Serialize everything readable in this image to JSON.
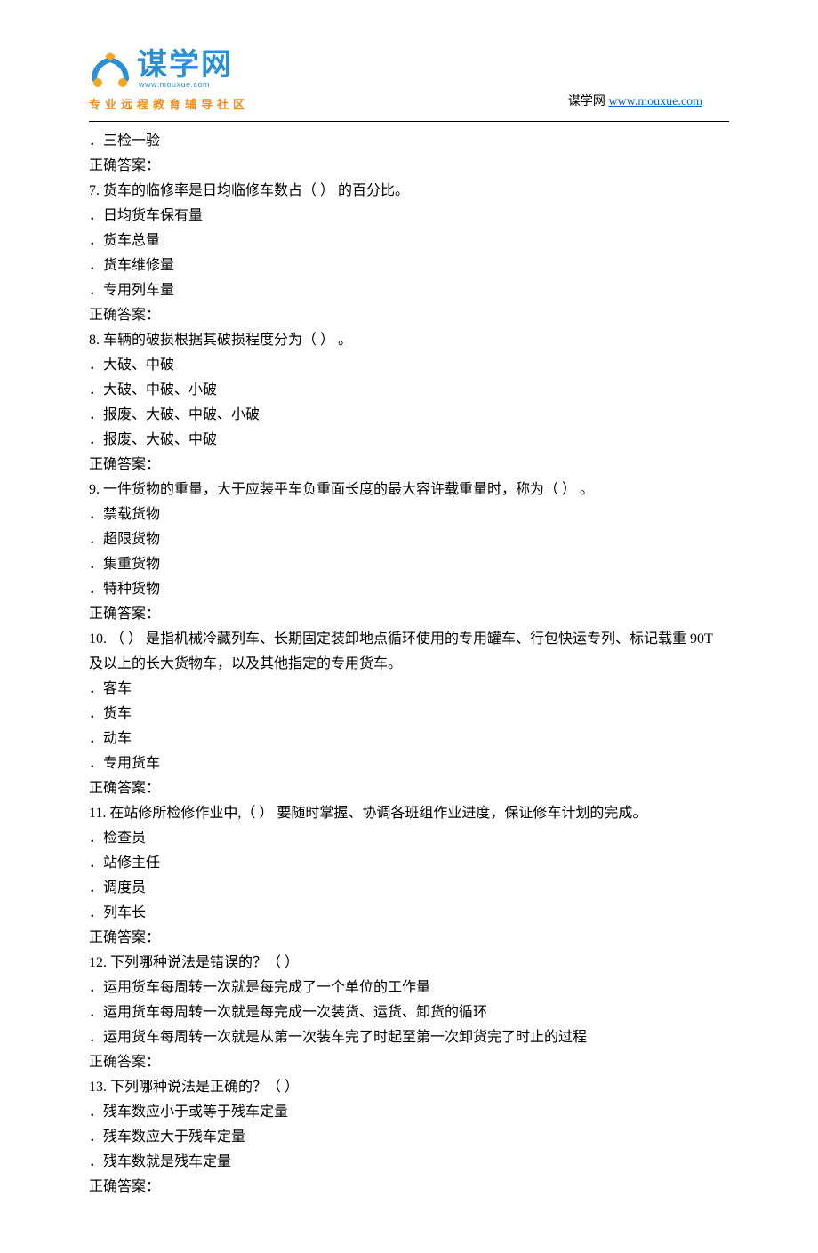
{
  "header": {
    "logo_text": "谋学网",
    "logo_url": "www.mouxue.com",
    "logo_sub": "专业远程教育辅导社区",
    "right_label": "谋学网",
    "right_link": "www.mouxue.com"
  },
  "q6_tail_opt": "．三检一验",
  "answer_label": "正确答案：",
  "q7": {
    "stem": "7.   货车的临修率是日均临修车数占（ ） 的百分比。",
    "opts": [
      "．日均货车保有量",
      "．货车总量",
      "．货车维修量",
      "．专用列车量"
    ]
  },
  "q8": {
    "stem": "8.   车辆的破损根据其破损程度分为（ ） 。",
    "opts": [
      "．大破、中破",
      "．大破、中破、小破",
      "．报废、大破、中破、小破",
      "．报废、大破、中破"
    ]
  },
  "q9": {
    "stem": "9.   一件货物的重量，大于应装平车负重面长度的最大容许载重量时，称为（ ） 。",
    "opts": [
      "．禁载货物",
      "．超限货物",
      "．集重货物",
      "．特种货物"
    ]
  },
  "q10": {
    "stem": "10.   （ ） 是指机械冷藏列车、长期固定装卸地点循环使用的专用罐车、行包快运专列、标记载重 90T 及以上的长大货物车，以及其他指定的专用货车。",
    "opts": [
      "．客车",
      "．货车",
      "．动车",
      "．专用货车"
    ]
  },
  "q11": {
    "stem": "11.   在站修所检修作业中,（ ） 要随时掌握、协调各班组作业进度，保证修车计划的完成。",
    "opts": [
      "．检查员",
      "．站修主任",
      "．调度员",
      "．列车长"
    ]
  },
  "q12": {
    "stem": "12.   下列哪种说法是错误的？（ ）",
    "opts": [
      "．运用货车每周转一次就是每完成了一个单位的工作量",
      "．运用货车每周转一次就是每完成一次装货、运货、卸货的循环",
      "．运用货车每周转一次就是从第一次装车完了时起至第一次卸货完了时止的过程"
    ]
  },
  "q13": {
    "stem": "13.   下列哪种说法是正确的？（ ）",
    "opts": [
      "．残车数应小于或等于残车定量",
      "．残车数应大于残车定量",
      "．残车数就是残车定量"
    ]
  }
}
